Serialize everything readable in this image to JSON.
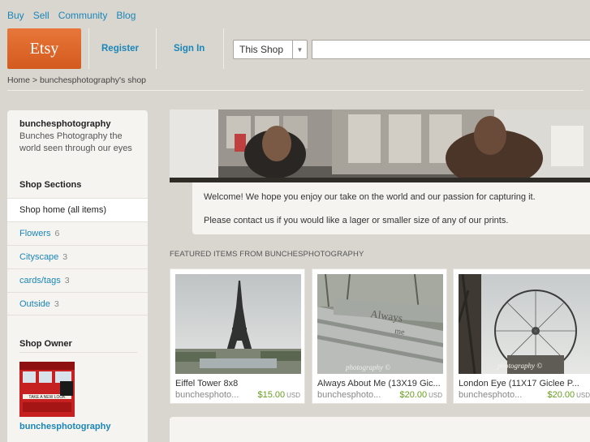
{
  "topnav": {
    "items": [
      "Buy",
      "Sell",
      "Community",
      "Blog"
    ]
  },
  "header": {
    "logo": "Etsy",
    "register": "Register",
    "signin": "Sign In",
    "search_scope": "This Shop",
    "search_value": ""
  },
  "breadcrumb": "Home > bunchesphotography's shop",
  "sidebar": {
    "shop_name": "bunchesphotography",
    "shop_desc": "Bunches Photography the world seen through our eyes",
    "sections_title": "Shop Sections",
    "sections": [
      {
        "label": "Shop home (all items)",
        "count": ""
      },
      {
        "label": "Flowers",
        "count": "6"
      },
      {
        "label": "Cityscape",
        "count": "3"
      },
      {
        "label": "cards/tags",
        "count": "3"
      },
      {
        "label": "Outside",
        "count": "3"
      }
    ],
    "owner_title": "Shop Owner",
    "owner_name": "bunchesphotography",
    "owner_img_sign": "TAKE A NEW LOOK"
  },
  "welcome": {
    "line1": "Welcome! We hope you enjoy our take on the world and our passion for capturing it.",
    "line2": "Please contact us if you would like a lager or smaller size of any of our prints."
  },
  "featured": {
    "title": "Featured items from bunchesphotography",
    "items": [
      {
        "title": "Eiffel Tower 8x8",
        "seller": "bunchesphoto...",
        "price": "$15.00",
        "currency": "USD"
      },
      {
        "title": "Always About Me (13X19 Gic...",
        "seller": "bunchesphoto...",
        "price": "$20.00",
        "currency": "USD",
        "photo_text": "Always",
        "photo_text2": "me",
        "watermark": "photography ©"
      },
      {
        "title": "London Eye (11X17 Giclee P...",
        "seller": "bunchesphoto...",
        "price": "$20.00",
        "currency": "USD",
        "watermark": "photography ©"
      }
    ]
  },
  "colors": {
    "link": "#1a86b8",
    "price": "#65a11c",
    "logo": "#e06a2c",
    "background": "#d9d6cf"
  }
}
